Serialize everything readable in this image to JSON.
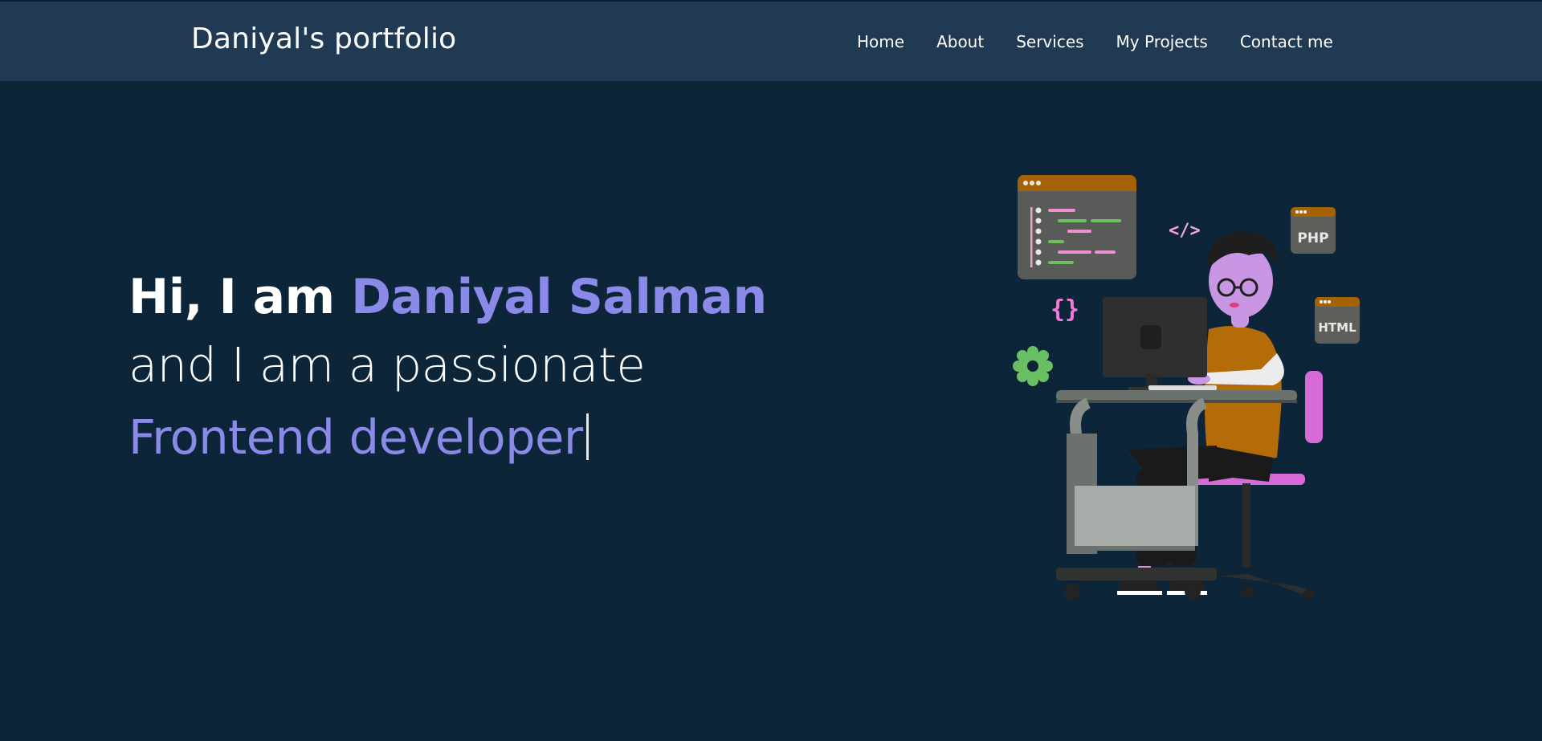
{
  "navbar": {
    "brand": "Daniyal's portfolio",
    "links": [
      "Home",
      "About",
      "Services",
      "My Projects",
      "Contact me"
    ]
  },
  "hero": {
    "greeting": "Hi, I am",
    "name": "Daniyal Salman",
    "line2": "and I am a passionate",
    "role": "Frontend developer"
  },
  "illustration": {
    "badges": [
      "PHP",
      "HTML"
    ],
    "symbols": [
      "</>",
      "{}"
    ]
  },
  "colors": {
    "background": "#0c2539",
    "navbar": "#1f3a52",
    "accent": "#8b8ae8",
    "text": "#ffffff"
  }
}
